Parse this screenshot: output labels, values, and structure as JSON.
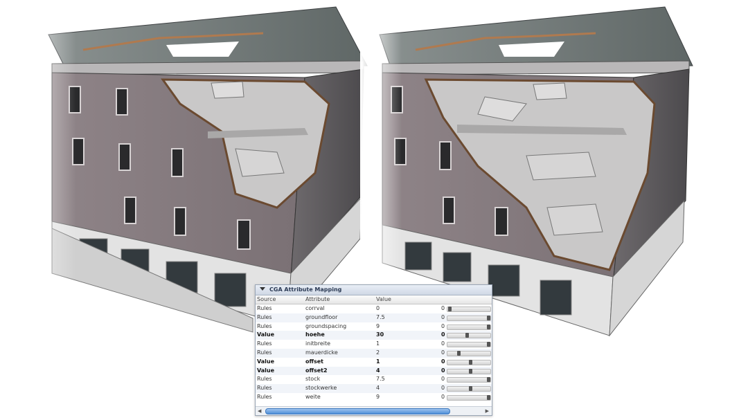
{
  "panel": {
    "title": "CGA Attribute Mapping",
    "columns": [
      "Source",
      "Attribute",
      "Value"
    ],
    "rows": [
      {
        "source": "Rules",
        "attribute": "corrval",
        "value": "0",
        "min": "0",
        "level": 0.02,
        "bold": false
      },
      {
        "source": "Rules",
        "attribute": "groundfloor",
        "value": "7.5",
        "min": "0",
        "level": 1.0,
        "bold": false
      },
      {
        "source": "Rules",
        "attribute": "groundspacing",
        "value": "9",
        "min": "0",
        "level": 1.0,
        "bold": false
      },
      {
        "source": "Value",
        "attribute": "hoehe",
        "value": "30",
        "min": "0",
        "level": 0.45,
        "bold": true
      },
      {
        "source": "Rules",
        "attribute": "initbreite",
        "value": "1",
        "min": "0",
        "level": 1.0,
        "bold": false
      },
      {
        "source": "Rules",
        "attribute": "mauerdicke",
        "value": "2",
        "min": "0",
        "level": 0.25,
        "bold": false
      },
      {
        "source": "Value",
        "attribute": "offset",
        "value": "1",
        "min": "0",
        "level": 0.55,
        "bold": true
      },
      {
        "source": "Value",
        "attribute": "offset2",
        "value": "4",
        "min": "0",
        "level": 0.55,
        "bold": true
      },
      {
        "source": "Rules",
        "attribute": "stock",
        "value": "7.5",
        "min": "0",
        "level": 1.0,
        "bold": false
      },
      {
        "source": "Rules",
        "attribute": "stockwerke",
        "value": "4",
        "min": "0",
        "level": 0.55,
        "bold": false
      },
      {
        "source": "Rules",
        "attribute": "weite",
        "value": "9",
        "min": "0",
        "level": 1.0,
        "bold": false
      }
    ]
  },
  "icons": [
    "disclosure-triangle-icon",
    "scroll-left-arrow-icon",
    "scroll-right-arrow-icon"
  ]
}
